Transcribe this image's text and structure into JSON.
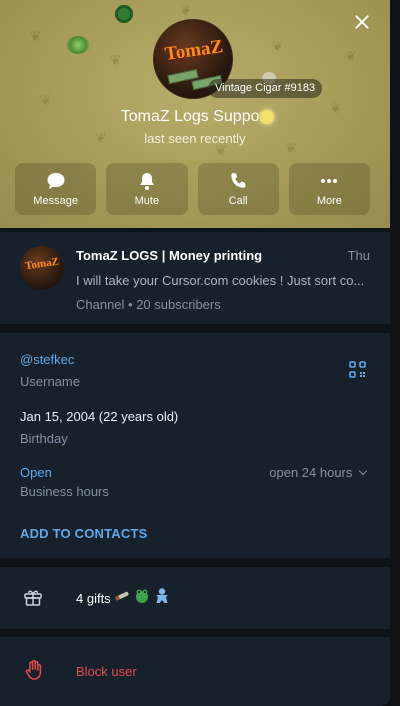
{
  "header": {
    "bg_color": "#a99e5c",
    "gift_badge": "Vintage Cigar #9183",
    "name": "TomaZ Logs Support",
    "status": "last seen recently",
    "avatar_logo_text": "TomaZ"
  },
  "actions": [
    {
      "label": "Message",
      "icon": "message-icon"
    },
    {
      "label": "Mute",
      "icon": "bell-icon"
    },
    {
      "label": "Call",
      "icon": "phone-icon"
    },
    {
      "label": "More",
      "icon": "more-dots-icon"
    }
  ],
  "channel": {
    "title": "TomaZ LOGS | Money printing",
    "date": "Thu",
    "message": "I will take your Cursor.com cookies ! Just sort co...",
    "meta": "Channel • 20 subscribers",
    "avatar_logo_text": "TomaZ"
  },
  "info": {
    "username_value": "@stefkec",
    "username_label": "Username",
    "birthday_value": "Jan 15, 2004 (22 years old)",
    "birthday_label": "Birthday",
    "hours_value": "Open",
    "hours_label": "Business hours",
    "hours_detail": "open 24 hours",
    "add_contacts": "ADD TO CONTACTS"
  },
  "gifts": {
    "text": "4 gifts",
    "icons": [
      "cigar-gift-icon",
      "frog-gift-icon",
      "gingerbread-gift-icon"
    ]
  },
  "block": {
    "label": "Block user"
  },
  "colors": {
    "accent": "#5fa8e9",
    "danger": "#e5484d",
    "panel_bg": "#17212b",
    "muted": "#7f91a4"
  }
}
